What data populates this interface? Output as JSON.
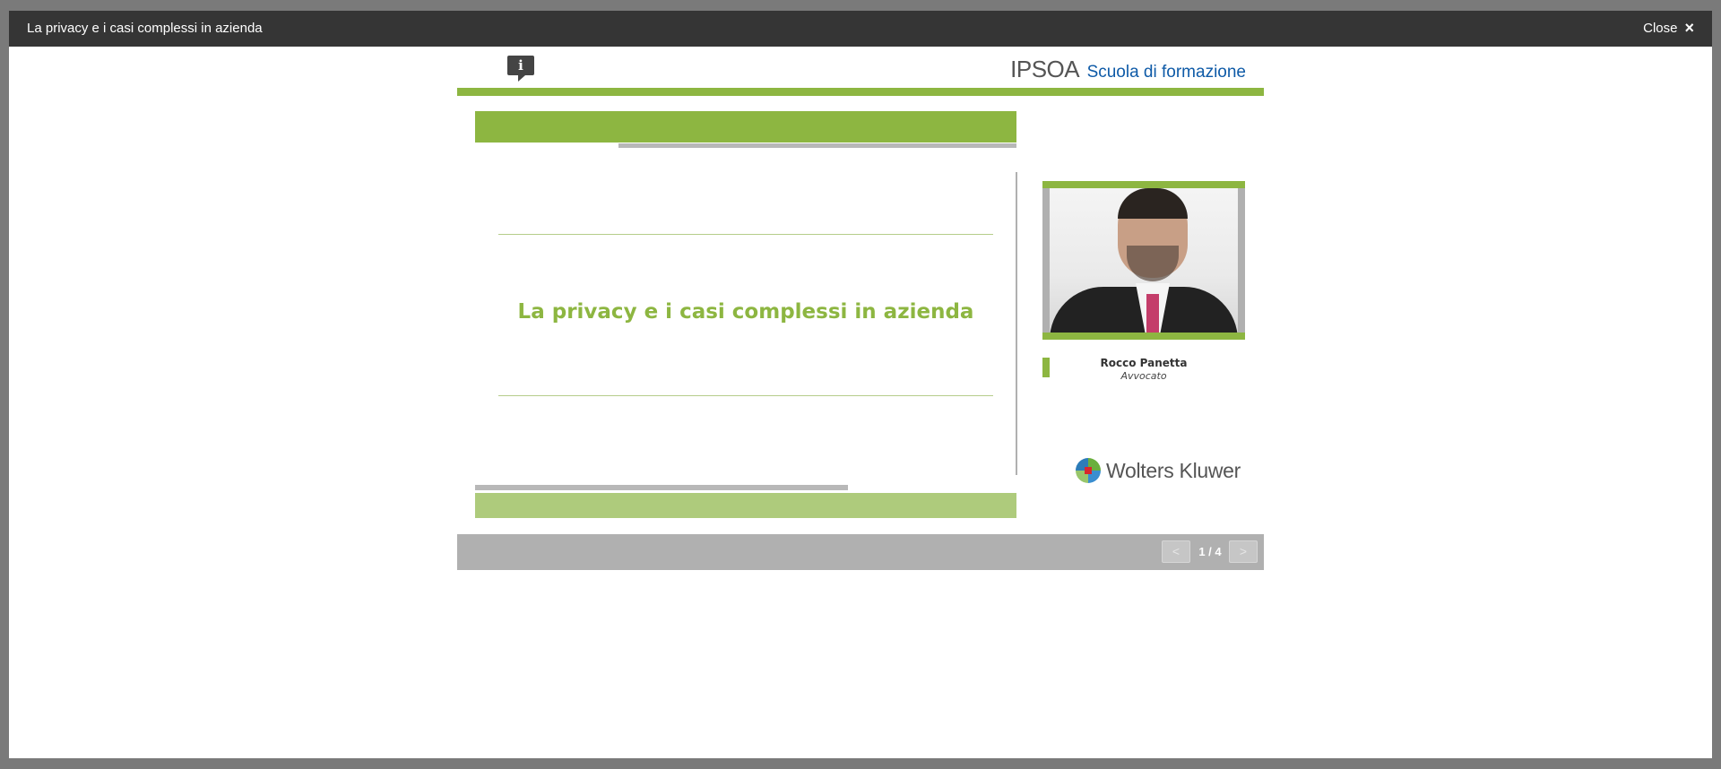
{
  "window": {
    "title": "La privacy e i casi complessi in azienda",
    "close_label": "Close",
    "close_icon": "×"
  },
  "slide": {
    "info_icon": "i",
    "brand": {
      "name": "IPSOA",
      "tagline": "Scuola di formazione"
    },
    "title": "La privacy e i casi complessi in azienda",
    "speaker": {
      "name": "Rocco Panetta",
      "role": "Avvocato"
    },
    "publisher_logo": "Wolters Kluwer"
  },
  "navigation": {
    "prev_label": "<",
    "next_label": ">",
    "page_indicator": "1 / 4"
  },
  "colors": {
    "accent_green": "#8db641",
    "light_green": "#aecb7c",
    "brand_blue": "#0e5aa7",
    "titlebar": "#353535",
    "navbar": "#b0b0b0"
  }
}
